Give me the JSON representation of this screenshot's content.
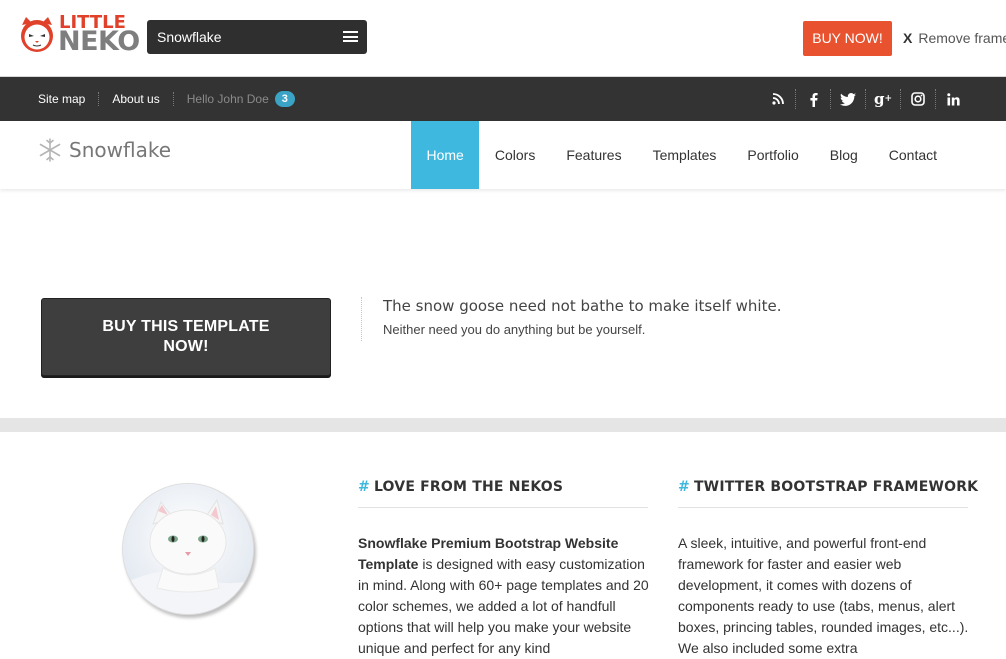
{
  "frame": {
    "logo": {
      "word1": "LITTLE",
      "word2": "NEKO"
    },
    "theme_select": {
      "value": "Snowflake",
      "icon": "menu-icon"
    },
    "buy_now": "BUY NOW!",
    "remove_frame": {
      "x": "X",
      "label": "Remove frame"
    }
  },
  "infobar": {
    "links": [
      "Site map",
      "About us"
    ],
    "hello": "Hello John Doe",
    "badge_count": "3",
    "social": [
      "rss-icon",
      "facebook-icon",
      "twitter-icon",
      "google-plus-icon",
      "instagram-icon",
      "linkedin-icon"
    ]
  },
  "nav": {
    "brand": "Snowflake",
    "items": [
      {
        "label": "Home",
        "active": true
      },
      {
        "label": "Colors"
      },
      {
        "label": "Features"
      },
      {
        "label": "Templates"
      },
      {
        "label": "Portfolio"
      },
      {
        "label": "Blog"
      },
      {
        "label": "Contact"
      }
    ]
  },
  "hero": {
    "buy_button_line1": "BUY THIS TEMPLATE",
    "buy_button_line2": "NOW!",
    "quote_line1": "The snow goose need not bathe to make itself white.",
    "quote_line2": "Neither need you do anything but be yourself."
  },
  "columns": [
    {
      "hash": "#",
      "title": "LOVE FROM THE NEKOS",
      "bold_text": "Snowflake Premium Bootstrap Website Template",
      "text": " is designed with easy customization in mind. Along with 60+ page templates and 20 color schemes, we added a lot of handfull options that will help you make your website unique and perfect for any kind"
    },
    {
      "hash": "#",
      "title": "TWITTER BOOTSTRAP FRAMEWORK",
      "text": "A sleek, intuitive, and powerful front-end framework for faster and easier web development, it comes with dozens of components ready to use (tabs, menus, alert boxes, princing tables, rounded images, etc...). We also included some extra"
    }
  ],
  "colors": {
    "accent": "#3fb8e0",
    "buy_now": "#e8522f",
    "dark_bar": "#333333"
  }
}
